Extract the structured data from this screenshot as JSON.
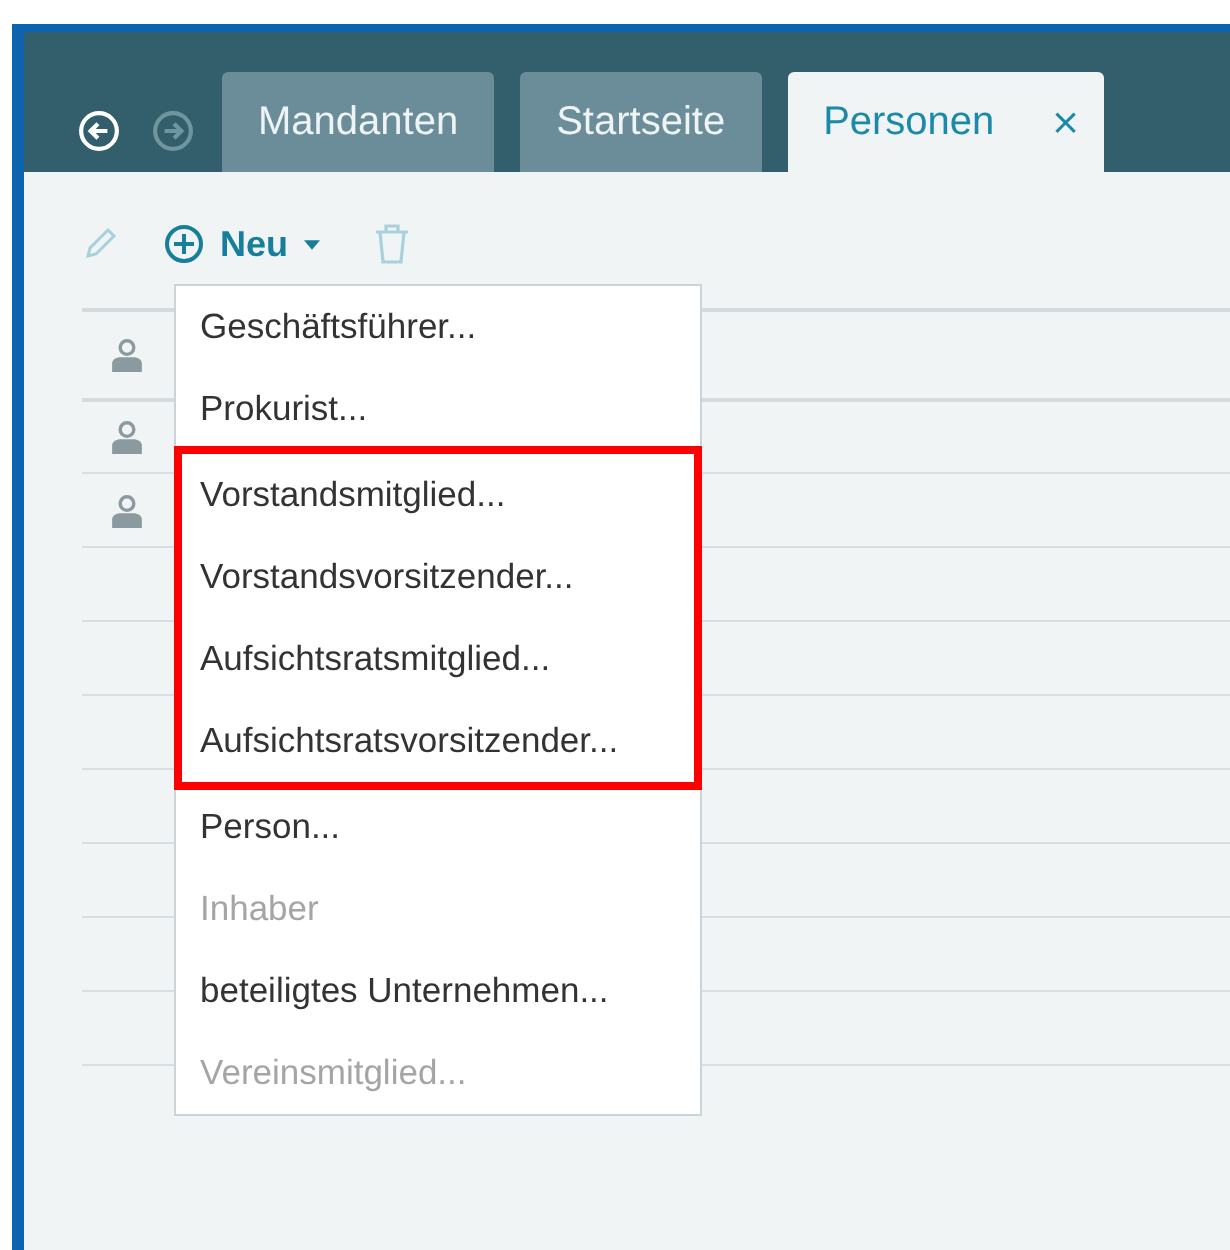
{
  "tabs": [
    {
      "label": "Mandanten",
      "selected": false
    },
    {
      "label": "Startseite",
      "selected": false
    },
    {
      "label": "Personen",
      "selected": true,
      "close": "×"
    }
  ],
  "nav": {
    "back_disabled": false,
    "forward_disabled": true
  },
  "toolbar": {
    "edit_disabled": true,
    "new_label": "Neu",
    "delete_disabled": true
  },
  "rows": [
    {
      "kind": "person"
    },
    {
      "kind": "person"
    },
    {
      "kind": "person"
    },
    {
      "kind": "empty"
    },
    {
      "kind": "empty"
    },
    {
      "kind": "empty"
    },
    {
      "kind": "empty"
    },
    {
      "kind": "empty"
    },
    {
      "kind": "empty"
    },
    {
      "kind": "empty"
    },
    {
      "kind": "empty"
    }
  ],
  "menu": {
    "sections": [
      {
        "highlighted": false,
        "items": [
          {
            "label": "Geschäftsführer...",
            "disabled": false
          },
          {
            "label": "Prokurist...",
            "disabled": false
          }
        ]
      },
      {
        "highlighted": true,
        "items": [
          {
            "label": "Vorstandsmitglied...",
            "disabled": false
          },
          {
            "label": "Vorstandsvorsitzender...",
            "disabled": false
          },
          {
            "label": "Aufsichtsratsmitglied...",
            "disabled": false
          },
          {
            "label": "Aufsichtsratsvorsitzender...",
            "disabled": false
          }
        ]
      },
      {
        "highlighted": false,
        "items": [
          {
            "label": "Person...",
            "disabled": false
          },
          {
            "label": "Inhaber",
            "disabled": true
          },
          {
            "label": "beteiligtes Unternehmen...",
            "disabled": false
          },
          {
            "label": "Vereinsmitglied...",
            "disabled": true
          }
        ]
      }
    ]
  }
}
